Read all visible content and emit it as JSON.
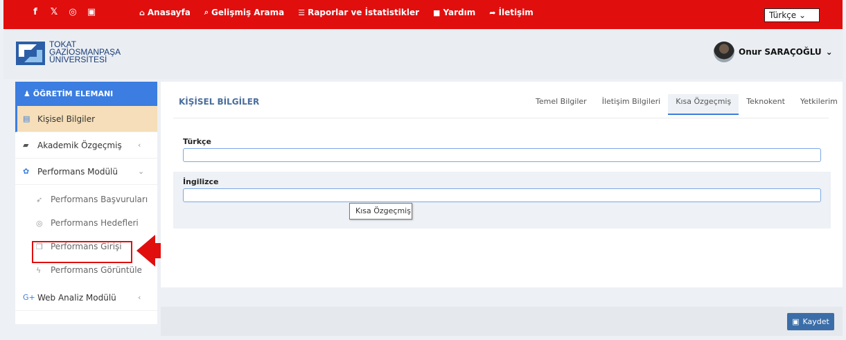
{
  "topbar": {
    "social_icons": [
      "facebook-icon",
      "x-icon",
      "instagram-icon",
      "youtube-icon"
    ],
    "nav": [
      {
        "icon": "home-icon",
        "label": "Anasayfa"
      },
      {
        "icon": "search-icon",
        "label": "Gelişmiş Arama"
      },
      {
        "icon": "list-icon",
        "label": "Raporlar ve İstatistikler"
      },
      {
        "icon": "video-icon",
        "label": "Yardım"
      },
      {
        "icon": "share-icon",
        "label": "İletişim"
      }
    ],
    "language": "Türkçe",
    "background_color": "#e10e0e"
  },
  "header": {
    "logo_lines": [
      "TOKAT",
      "GAZİOSMANPAŞA",
      "ÜNİVERSİTESİ"
    ],
    "user_name": "Onur SARAÇOĞLU"
  },
  "sidebar": {
    "heading": "ÖĞRETİM ELEMANI",
    "items": [
      {
        "label": "Kişisel Bilgiler",
        "icon": "id-card-icon",
        "active": true
      },
      {
        "label": "Akademik Özgeçmiş",
        "icon": "book-icon"
      },
      {
        "label": "Performans Modülü",
        "icon": "palette-icon",
        "expanded": true
      },
      {
        "label": "Web Analiz Modülü",
        "icon": "google-plus-icon"
      }
    ],
    "subitems": [
      {
        "label": "Performans Başvuruları",
        "icon": "paper-plane-icon"
      },
      {
        "label": "Performans Hedefleri",
        "icon": "target-icon"
      },
      {
        "label": "Performans Girişi",
        "icon": "copy-icon",
        "highlighted": true
      },
      {
        "label": "Performans Görüntüle",
        "icon": "bolt-icon"
      }
    ],
    "accent_color": "#3b7de0"
  },
  "main": {
    "title": "KİŞİSEL BİLGİLER",
    "tabs": [
      "Temel Bilgiler",
      "İletişim Bilgileri",
      "Kısa Özgeçmiş",
      "Teknokent",
      "Yetkilerim"
    ],
    "active_tab": "Kısa Özgeçmiş",
    "fields": [
      {
        "label": "Türkçe",
        "value": ""
      },
      {
        "label": "İngilizce",
        "value": ""
      }
    ],
    "tooltip": "Kısa Özgeçmiş"
  },
  "footer": {
    "save_label": "Kaydet"
  },
  "annotation": {
    "color": "#e10e0e"
  }
}
